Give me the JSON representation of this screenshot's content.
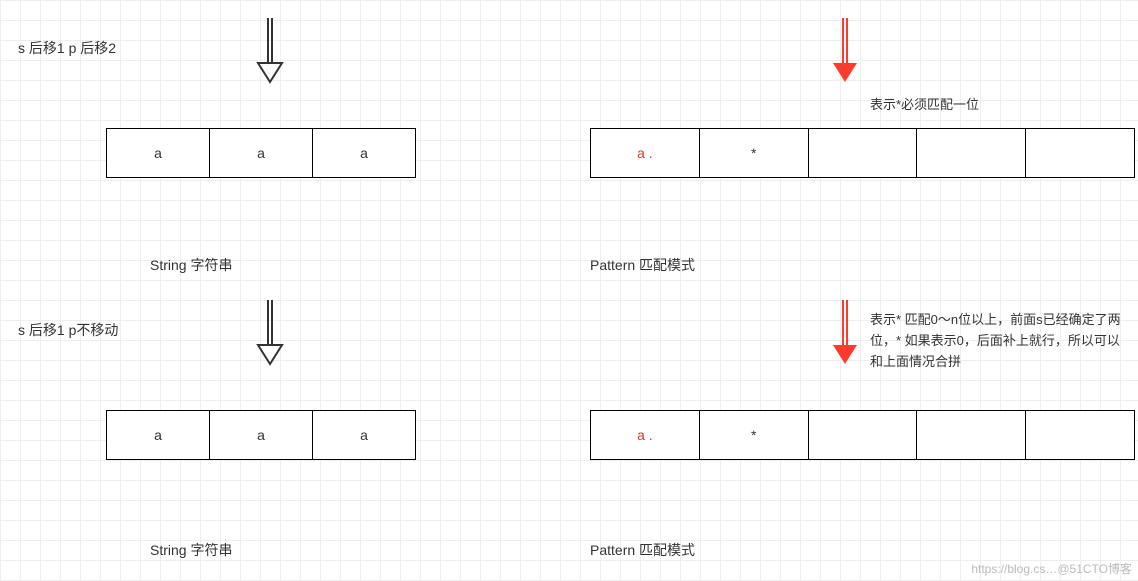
{
  "row1": {
    "left_note": "s 后移1 p 后移2",
    "right_note": "表示*必须匹配一位",
    "string_cells": [
      "a",
      "a",
      "a"
    ],
    "pattern_cells": [
      "a  .",
      "*",
      "",
      "",
      ""
    ],
    "string_caption": "String 字符串",
    "pattern_caption": "Pattern 匹配模式"
  },
  "row2": {
    "left_note": "s 后移1 p不移动",
    "right_note": "表示* 匹配0～n位以上，前面s已经确定了两位，* 如果表示0，后面补上就行，所以可以和上面情况合拼",
    "string_cells": [
      "a",
      "a",
      "a"
    ],
    "pattern_cells": [
      "a  .",
      "*",
      "",
      "",
      ""
    ],
    "string_caption": "String 字符串",
    "pattern_caption": "Pattern 匹配模式"
  },
  "watermark": "https://blog.cs…@51CTO博客"
}
